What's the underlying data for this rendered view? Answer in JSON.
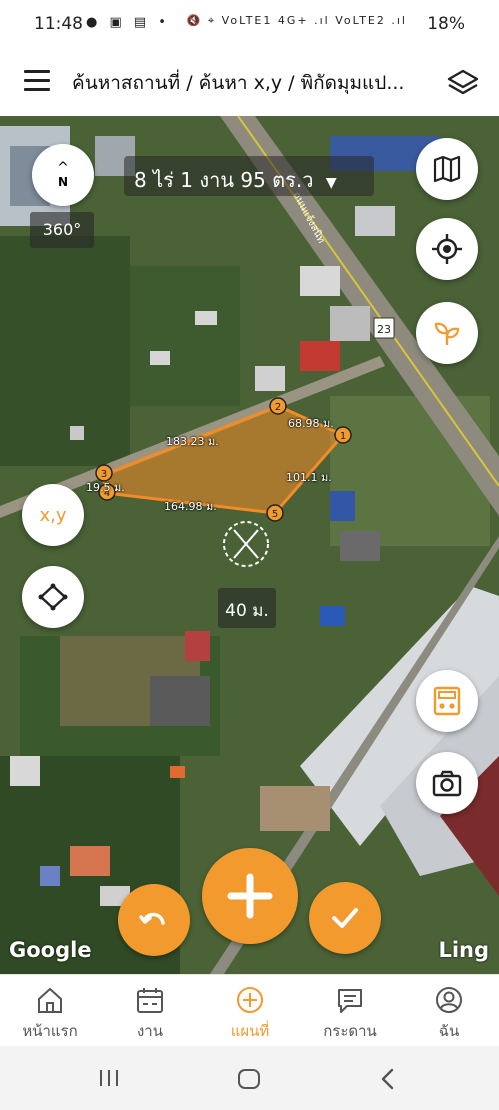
{
  "status": {
    "time": "11:48",
    "left_icons": "● ▣ ▤ •",
    "right_icons": "🔇 ⌖ VoLTE1 4G+ .ıl VoLTE2 .ıl",
    "battery": "18%"
  },
  "appbar": {
    "title": "ค้นหาสถานที่ / ค้นหา x,y / พิกัดมุมแป...",
    "menu_icon": "hamburger-icon",
    "layers_icon": "layers-icon"
  },
  "map": {
    "area_label": "8 ไร่ 1 งาน 95 ตร.ว",
    "compass_label": "N",
    "rotation_label": "360°",
    "scale_label": "40 ม.",
    "highway_number": "23",
    "road_name": "ถนนแจ้งสนิท",
    "google_label": "Google",
    "ling_label": "Ling",
    "xy_button": "x,y",
    "vertices": [
      {
        "id": "1",
        "label": "1"
      },
      {
        "id": "2",
        "label": "2"
      },
      {
        "id": "3",
        "label": "3"
      },
      {
        "id": "4",
        "label": "4"
      },
      {
        "id": "5",
        "label": "5"
      }
    ],
    "distances": {
      "d23": "183.23 ม.",
      "d12": "68.98 ม.",
      "d15": "101.1 ม.",
      "d45": "164.98 ม.",
      "d34": "19.5 ม."
    }
  },
  "colors": {
    "accent": "#f29a2e",
    "polygon_fill": "rgba(242,140,40,0.55)",
    "polygon_stroke": "#f28c28"
  },
  "bottom_nav": [
    {
      "label": "หน้าแรก",
      "icon": "home-icon",
      "active": false
    },
    {
      "label": "งาน",
      "icon": "calendar-icon",
      "active": false
    },
    {
      "label": "แผนที่",
      "icon": "map-plus-icon",
      "active": true
    },
    {
      "label": "กระดาน",
      "icon": "board-icon",
      "active": false
    },
    {
      "label": "ฉัน",
      "icon": "profile-icon",
      "active": false
    }
  ]
}
